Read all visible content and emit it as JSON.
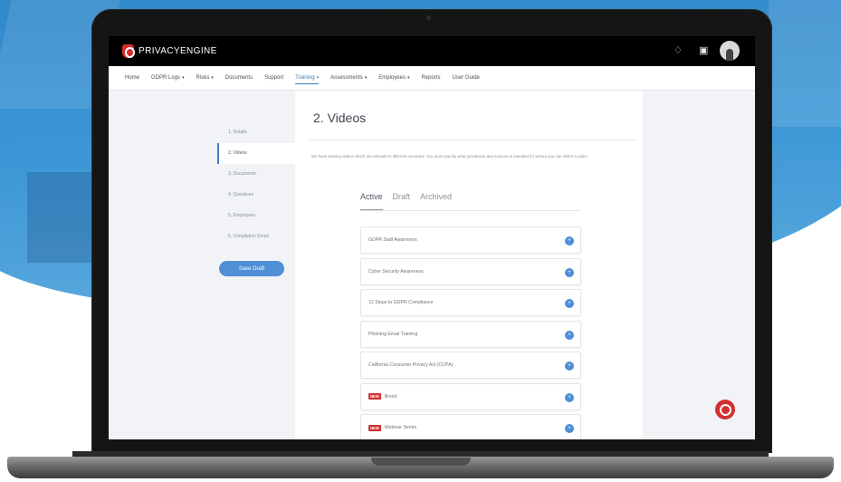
{
  "app": {
    "brand": "PRIVACYENGINE",
    "accent_color": "#4f8fd6",
    "brand_color": "#d32f2f"
  },
  "topbar": {
    "icons": [
      "bell-icon",
      "gift-icon",
      "avatar"
    ]
  },
  "menu": {
    "items": [
      {
        "label": "Home",
        "has_caret": false
      },
      {
        "label": "GDPR Logs",
        "has_caret": true
      },
      {
        "label": "Risks",
        "has_caret": true
      },
      {
        "label": "Documents",
        "has_caret": false
      },
      {
        "label": "Support",
        "has_caret": false
      },
      {
        "label": "Training",
        "has_caret": true,
        "active": true
      },
      {
        "label": "Assessments",
        "has_caret": true
      },
      {
        "label": "Employees",
        "has_caret": true
      },
      {
        "label": "Reports",
        "has_caret": false
      },
      {
        "label": "User Guide",
        "has_caret": false
      }
    ],
    "caret": "▾"
  },
  "steps": {
    "items": [
      "1. Details",
      "2. Videos",
      "3. Documents",
      "4. Questions",
      "5. Employees",
      "6. Completion Email"
    ],
    "active_index": 1,
    "save_draft_label": "Save Draft"
  },
  "main": {
    "title": "2. Videos",
    "description": "We have training videos which are relevant to different countries. You must specify what jurisdiction and sources is intended for before you can select a video.",
    "tabs": [
      "Active",
      "Draft",
      "Archived"
    ],
    "active_tab": 0,
    "videos": [
      {
        "label": "GDPR Staff Awareness",
        "is_new": false
      },
      {
        "label": "Cyber Security Awareness",
        "is_new": false
      },
      {
        "label": "12 Steps to GDPR Compliance",
        "is_new": false
      },
      {
        "label": "Phishing Email Training",
        "is_new": false
      },
      {
        "label": "California Consumer Privacy Act (CCPA)",
        "is_new": false
      },
      {
        "label": "Brexit",
        "is_new": true
      },
      {
        "label": "Webinar Series",
        "is_new": true
      }
    ],
    "new_badge": "NEW",
    "expand_icon": "+"
  }
}
